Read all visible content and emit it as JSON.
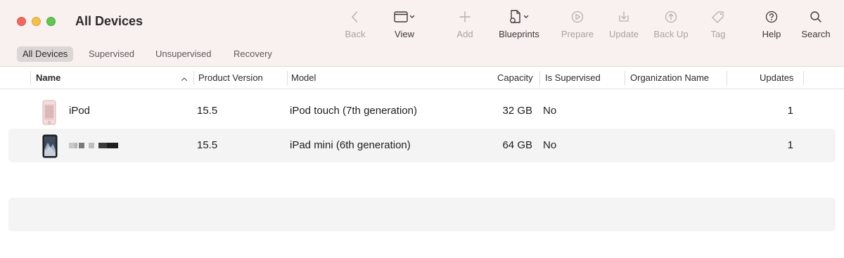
{
  "window": {
    "title": "All Devices"
  },
  "toolbar": {
    "back": {
      "label": "Back",
      "icon": "chevron-left-icon",
      "enabled": false
    },
    "view": {
      "label": "View",
      "icon": "window-layout-icon",
      "enabled": true
    },
    "add": {
      "label": "Add",
      "icon": "plus-icon",
      "enabled": false
    },
    "blueprints": {
      "label": "Blueprints",
      "icon": "blueprint-document-icon",
      "enabled": true
    },
    "prepare": {
      "label": "Prepare",
      "icon": "prepare-gear-icon",
      "enabled": false
    },
    "update": {
      "label": "Update",
      "icon": "update-download-icon",
      "enabled": false
    },
    "backup": {
      "label": "Back Up",
      "icon": "backup-upload-icon",
      "enabled": false
    },
    "tag": {
      "label": "Tag",
      "icon": "tag-icon",
      "enabled": false
    },
    "help": {
      "label": "Help",
      "icon": "question-circle-icon",
      "enabled": true
    },
    "search": {
      "label": "Search",
      "icon": "magnifier-icon",
      "enabled": true
    }
  },
  "tabs": [
    {
      "label": "All Devices",
      "selected": true
    },
    {
      "label": "Supervised",
      "selected": false
    },
    {
      "label": "Unsupervised",
      "selected": false
    },
    {
      "label": "Recovery",
      "selected": false
    }
  ],
  "table": {
    "columns": {
      "name": "Name",
      "product_version": "Product Version",
      "model": "Model",
      "capacity": "Capacity",
      "is_supervised": "Is Supervised",
      "organization_name": "Organization Name",
      "updates": "Updates"
    },
    "sort": {
      "column": "Name",
      "direction": "ascending"
    },
    "rows": [
      {
        "name": "iPod",
        "device_icon": "ipod-touch-icon",
        "product_version": "15.5",
        "model": "iPod touch (7th generation)",
        "capacity": "32 GB",
        "is_supervised": "No",
        "organization_name": "",
        "updates": "1"
      },
      {
        "name": "",
        "name_redacted": true,
        "device_icon": "ipad-mini-icon",
        "product_version": "15.5",
        "model": "iPad mini (6th generation)",
        "capacity": "64 GB",
        "is_supervised": "No",
        "organization_name": "",
        "updates": "1"
      }
    ]
  },
  "colors": {
    "titlebar_bg": "#f9f1ef",
    "disabled_text": "#a9a3a1",
    "row_alt_bg": "#f4f4f4",
    "close": "#ed6a5e",
    "minimize": "#f5bf4f",
    "maximize": "#62c554"
  }
}
